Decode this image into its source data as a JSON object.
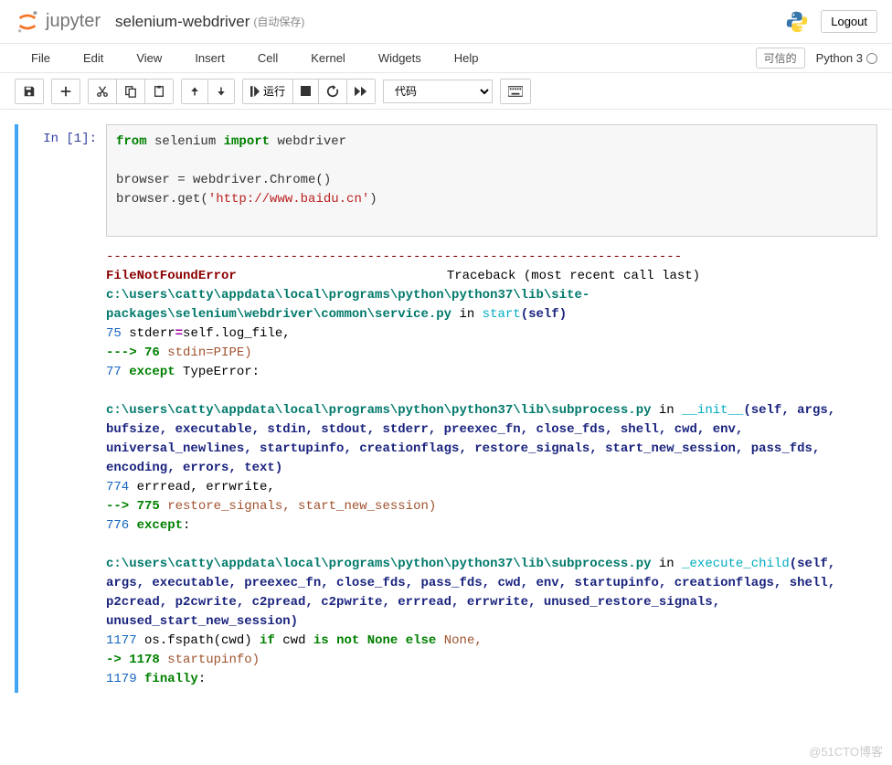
{
  "header": {
    "brand": "jupyter",
    "notebook_name": "selenium-webdriver",
    "autosave": "(自动保存)",
    "logout": "Logout"
  },
  "menu": {
    "items": [
      "File",
      "Edit",
      "View",
      "Insert",
      "Cell",
      "Kernel",
      "Widgets",
      "Help"
    ],
    "trusted": "可信的",
    "kernel": "Python 3"
  },
  "toolbar": {
    "run_label": "运行",
    "cell_type": "代码"
  },
  "cell": {
    "prompt": "In  [1]:",
    "code": {
      "l1_kw1": "from",
      "l1_mod": " selenium ",
      "l1_kw2": "import",
      "l1_name": " webdriver",
      "l3": "browser = webdriver.Chrome()",
      "l4_pre": "browser.get(",
      "l4_str": "'http://www.baidu.cn'",
      "l4_post": ")"
    }
  },
  "output": {
    "divider": "---------------------------------------------------------------------------",
    "error_name": "FileNotFoundError",
    "traceback_label": "Traceback (most recent call last)",
    "f1_path": "c:\\users\\catty\\appdata\\local\\programs\\python\\python37\\lib\\site-packages\\selenium\\webdriver\\common\\service.py",
    "in": " in ",
    "f1_func": "start",
    "f1_args": "(self)",
    "f1_l75_num": "     75 ",
    "f1_l75_code_pre": "                                          stderr",
    "f1_l75_code_op": "=",
    "f1_l75_code_post": "self.log_file,",
    "f1_l76_arrow": "---> ",
    "f1_l76_num": "76 ",
    "f1_l76_code": "                                          stdin=PIPE)",
    "f1_l77_num": "     77 ",
    "f1_l77_kw": "except",
    "f1_l77_post": " TypeError:",
    "f2_path": "c:\\users\\catty\\appdata\\local\\programs\\python\\python37\\lib\\subprocess.py",
    "f2_func": "__init__",
    "f2_args": "(self, args, bufsize, executable, stdin, stdout, stderr, preexec_fn, close_fds, shell, cwd, env, universal_newlines, startupinfo, creationflags, restore_signals, start_new_session, pass_fds, encoding, errors, text)",
    "f2_l774_num": "    774 ",
    "f2_l774_code": "                                errread, errwrite,",
    "f2_l775_arrow": "--> ",
    "f2_l775_num": "775 ",
    "f2_l775_code": "                                restore_signals, start_new_session)",
    "f2_l776_num": "    776 ",
    "f2_l776_kw": "except",
    "f2_l776_post": ":",
    "f3_path": "c:\\users\\catty\\appdata\\local\\programs\\python\\python37\\lib\\subprocess.py",
    "f3_func": "_execute_child",
    "f3_args": "(self, args, executable, preexec_fn, close_fds, pass_fds, cwd, env, startupinfo, creationflags, shell, p2cread, p2cwrite, c2pread, c2pwrite, errread, errwrite, unused_restore_signals, unused_start_new_session)",
    "f3_l1177_num": "   1177 ",
    "f3_l1177_pre": "                                     os.fspath(cwd) ",
    "f3_l1177_if": "if",
    "f3_l1177_mid": " cwd ",
    "f3_l1177_is": "is",
    "f3_l1177_not": " not ",
    "f3_l1177_none": "None",
    "f3_l1177_els": " else ",
    "f3_l1177_none2": "None,",
    "f3_l1178_arrow": "-> ",
    "f3_l1178_num": "1178 ",
    "f3_l1178_code": "                                         startupinfo)",
    "f3_l1179_num": "   1179 ",
    "f3_l1179_kw": "finally",
    "f3_l1179_post": ":"
  },
  "watermark": "@51CTO博客"
}
